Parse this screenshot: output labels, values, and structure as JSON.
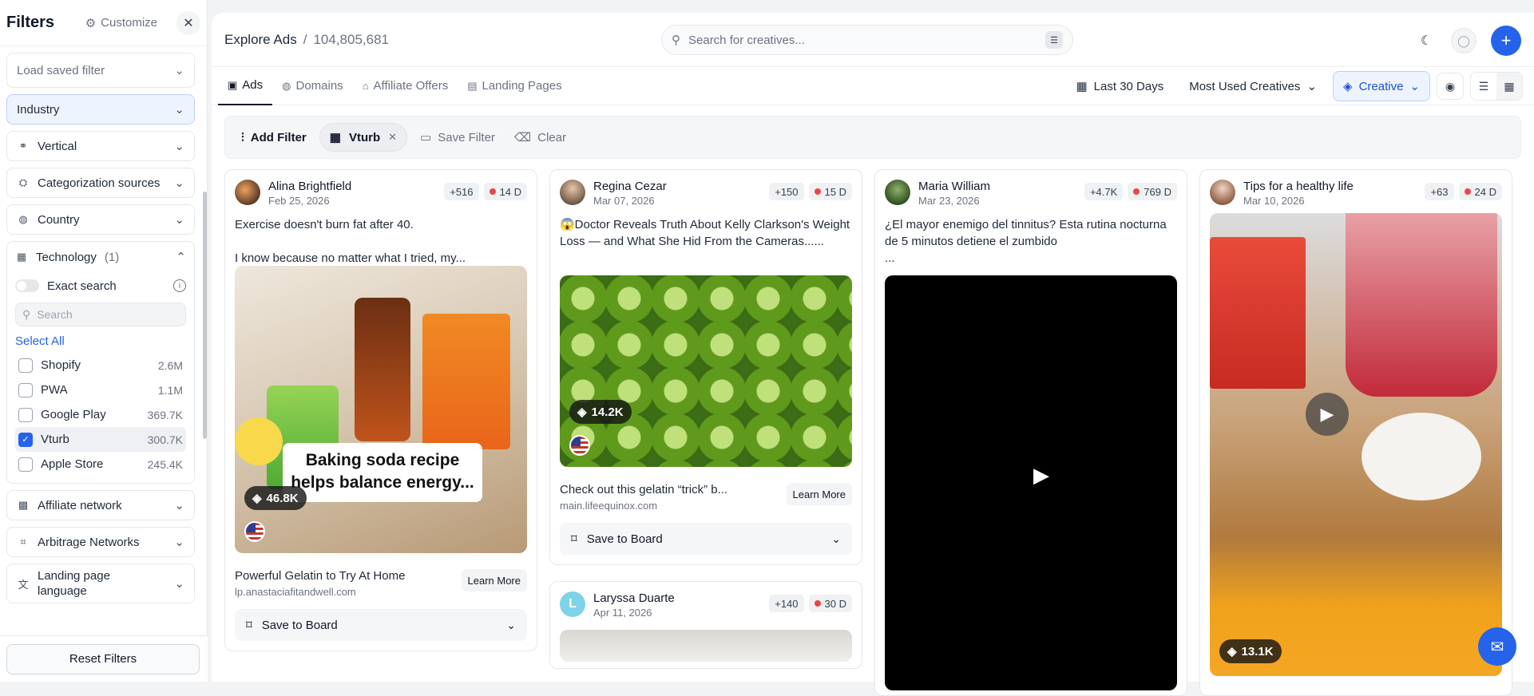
{
  "sidebar": {
    "title": "Filters",
    "customize_label": "Customize",
    "saved_filter_placeholder": "Load saved filter",
    "sections": {
      "industry": "Industry",
      "vertical": "Vertical",
      "categorization": "Categorization sources",
      "country": "Country",
      "affiliate": "Affiliate network",
      "arbitrage": "Arbitrage Networks",
      "landing_lang": "Landing page language"
    },
    "technology": {
      "label": "Technology",
      "count": "(1)",
      "exact_search": "Exact search",
      "search_placeholder": "Search",
      "select_all": "Select All",
      "items": [
        {
          "label": "Shopify",
          "count": "2.6M",
          "checked": false
        },
        {
          "label": "PWA",
          "count": "1.1M",
          "checked": false
        },
        {
          "label": "Google Play",
          "count": "369.7K",
          "checked": false
        },
        {
          "label": "Vturb",
          "count": "300.7K",
          "checked": true
        },
        {
          "label": "Apple Store",
          "count": "245.4K",
          "checked": false
        }
      ]
    },
    "reset_label": "Reset Filters"
  },
  "header": {
    "breadcrumb": "Explore Ads",
    "separator": "/",
    "count": "104,805,681",
    "search_placeholder": "Search for creatives..."
  },
  "tabs": [
    "Ads",
    "Domains",
    "Affiliate Offers",
    "Landing Pages"
  ],
  "controls": {
    "date_range": "Last 30 Days",
    "sort": "Most Used Creatives",
    "type": "Creative"
  },
  "filterbar": {
    "add_label": "Add Filter",
    "chip_label": "Vturb",
    "save_label": "Save Filter",
    "clear_label": "Clear"
  },
  "cards": [
    {
      "name": "Alina Brightfield",
      "date": "Feb 25, 2026",
      "badge": "+516",
      "days": "14 D",
      "text": "Exercise doesn't burn fat after 40.\n\nI know because no matter what I tried, my...",
      "stat": "46.8K",
      "overlay": "Baking soda recipe helps balance energy...",
      "foot_title": "Powerful Gelatin to Try At Home",
      "foot_url": "lp.anastaciafitandwell.com",
      "cta": "Learn More",
      "save": "Save to Board"
    },
    {
      "name": "Regina Cezar",
      "date": "Mar 07, 2026",
      "badge": "+150",
      "days": "15 D",
      "text": "😱Doctor Reveals Truth About Kelly Clarkson's Weight Loss — and What She Hid From the Cameras......",
      "stat": "14.2K",
      "foot_title": "Check out this gelatin “trick” b...",
      "foot_url": "main.lifeequinox.com",
      "cta": "Learn More",
      "save": "Save to Board"
    },
    {
      "name": "Maria William",
      "date": "Mar 23, 2026",
      "badge": "+4.7K",
      "days": "769 D",
      "text": "¿El mayor enemigo del tinnitus? Esta rutina nocturna de 5 minutos detiene el zumbido\n..."
    },
    {
      "name": "Tips for a healthy life",
      "date": "Mar 10, 2026",
      "badge": "+63",
      "days": "24 D",
      "stat": "13.1K"
    },
    {
      "name": "Laryssa Duarte",
      "date": "Apr 11, 2026",
      "badge": "+140",
      "days": "30 D",
      "initial": "L"
    }
  ],
  "colors": {
    "accent": "#2563eb",
    "badge_dot": "#ef4444"
  }
}
